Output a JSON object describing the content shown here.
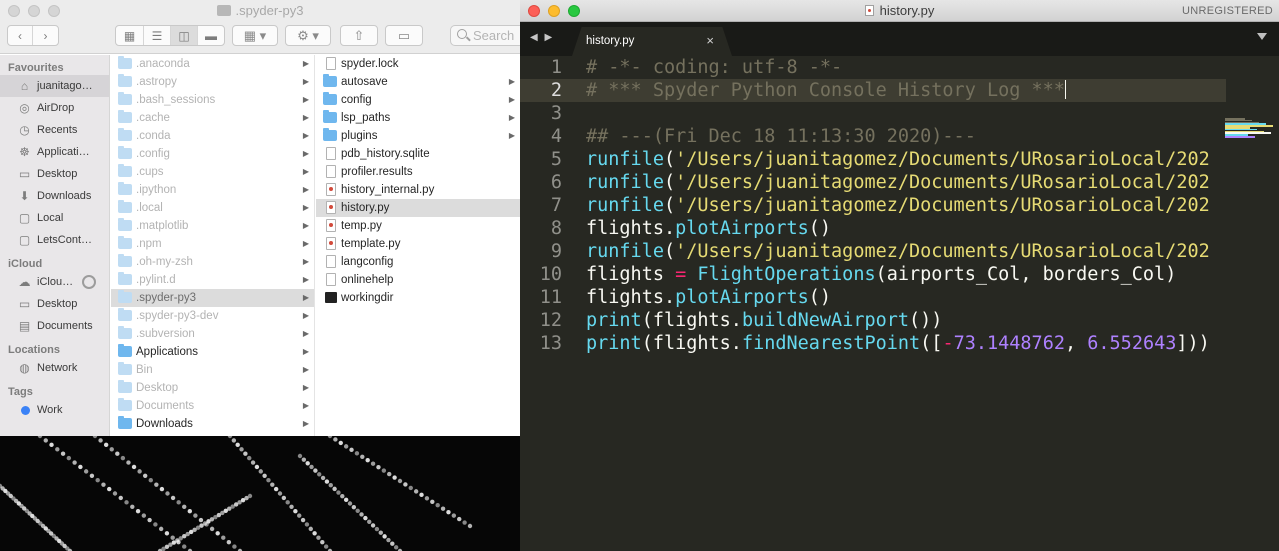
{
  "finder": {
    "window_title": ".spyder-py3",
    "search_placeholder": "Search",
    "sidebar": {
      "favourites_heading": "Favourites",
      "favourites": [
        {
          "label": "juanitago…",
          "icon": "home-icon",
          "selected": true
        },
        {
          "label": "AirDrop",
          "icon": "airdrop-icon"
        },
        {
          "label": "Recents",
          "icon": "clock-icon"
        },
        {
          "label": "Applicati…",
          "icon": "applications-icon"
        },
        {
          "label": "Desktop",
          "icon": "desktop-icon"
        },
        {
          "label": "Downloads",
          "icon": "downloads-icon"
        },
        {
          "label": "Local",
          "icon": "folder-icon"
        },
        {
          "label": "LetsCont…",
          "icon": "folder-icon"
        }
      ],
      "icloud_heading": "iCloud",
      "icloud": [
        {
          "label": "iClou…",
          "icon": "cloud-icon"
        },
        {
          "label": "Desktop",
          "icon": "desktop-icon"
        },
        {
          "label": "Documents",
          "icon": "document-icon"
        }
      ],
      "locations_heading": "Locations",
      "locations": [
        {
          "label": "Network",
          "icon": "globe-icon"
        }
      ],
      "tags_heading": "Tags",
      "tags": [
        {
          "label": "Work",
          "color": "#3b82f6"
        }
      ]
    },
    "column1": [
      {
        "name": ".anaconda",
        "dark": false
      },
      {
        "name": ".astropy",
        "dark": false
      },
      {
        "name": ".bash_sessions",
        "dark": false
      },
      {
        "name": ".cache",
        "dark": false
      },
      {
        "name": ".conda",
        "dark": false
      },
      {
        "name": ".config",
        "dark": false
      },
      {
        "name": ".cups",
        "dark": false
      },
      {
        "name": ".ipython",
        "dark": false
      },
      {
        "name": ".local",
        "dark": false
      },
      {
        "name": ".matplotlib",
        "dark": false
      },
      {
        "name": ".npm",
        "dark": false
      },
      {
        "name": ".oh-my-zsh",
        "dark": false
      },
      {
        "name": ".pylint.d",
        "dark": false
      },
      {
        "name": ".spyder-py3",
        "dark": false,
        "selected": true
      },
      {
        "name": ".spyder-py3-dev",
        "dark": false
      },
      {
        "name": ".subversion",
        "dark": false
      },
      {
        "name": "Applications",
        "dark": true
      },
      {
        "name": "Bin",
        "dark": false
      },
      {
        "name": "Desktop",
        "dark": false
      },
      {
        "name": "Documents",
        "dark": false
      },
      {
        "name": "Downloads",
        "dark": true
      }
    ],
    "column2": [
      {
        "name": "spyder.lock",
        "kind": "doc"
      },
      {
        "name": "autosave",
        "kind": "folder"
      },
      {
        "name": "config",
        "kind": "folder"
      },
      {
        "name": "lsp_paths",
        "kind": "folder"
      },
      {
        "name": "plugins",
        "kind": "folder"
      },
      {
        "name": "pdb_history.sqlite",
        "kind": "doc"
      },
      {
        "name": "profiler.results",
        "kind": "doc"
      },
      {
        "name": "history_internal.py",
        "kind": "py"
      },
      {
        "name": "history.py",
        "kind": "py",
        "selected": true
      },
      {
        "name": "temp.py",
        "kind": "py"
      },
      {
        "name": "template.py",
        "kind": "py"
      },
      {
        "name": "langconfig",
        "kind": "doc"
      },
      {
        "name": "onlinehelp",
        "kind": "doc"
      },
      {
        "name": "workingdir",
        "kind": "term"
      }
    ]
  },
  "editor": {
    "window_title": "history.py",
    "unregistered_label": "UNREGISTERED",
    "tab_label": "history.py",
    "tab_close": "×",
    "current_line": 2,
    "lines": [
      [
        {
          "t": "# -*- coding: utf-8 -*-",
          "c": "cmt"
        }
      ],
      [
        {
          "t": "# *** Spyder Python Console History Log ***",
          "c": "cmt"
        }
      ],
      [],
      [
        {
          "t": "## ---(Fri Dec 18 11:13:30 2020)---",
          "c": "cmt"
        }
      ],
      [
        {
          "t": "runfile",
          "c": "fn"
        },
        {
          "t": "(",
          "c": ""
        },
        {
          "t": "'/Users/juanitagomez/Documents/URosarioLocal/202",
          "c": "str"
        }
      ],
      [
        {
          "t": "runfile",
          "c": "fn"
        },
        {
          "t": "(",
          "c": ""
        },
        {
          "t": "'/Users/juanitagomez/Documents/URosarioLocal/202",
          "c": "str"
        }
      ],
      [
        {
          "t": "runfile",
          "c": "fn"
        },
        {
          "t": "(",
          "c": ""
        },
        {
          "t": "'/Users/juanitagomez/Documents/URosarioLocal/202",
          "c": "str"
        }
      ],
      [
        {
          "t": "flights.",
          "c": ""
        },
        {
          "t": "plotAirports",
          "c": "fn"
        },
        {
          "t": "()",
          "c": ""
        }
      ],
      [
        {
          "t": "runfile",
          "c": "fn"
        },
        {
          "t": "(",
          "c": ""
        },
        {
          "t": "'/Users/juanitagomez/Documents/URosarioLocal/202",
          "c": "str"
        }
      ],
      [
        {
          "t": "flights ",
          "c": ""
        },
        {
          "t": "=",
          "c": "op"
        },
        {
          "t": " ",
          "c": ""
        },
        {
          "t": "FlightOperations",
          "c": "fn"
        },
        {
          "t": "(airports_Col, borders_Col)",
          "c": ""
        }
      ],
      [
        {
          "t": "flights.",
          "c": ""
        },
        {
          "t": "plotAirports",
          "c": "fn"
        },
        {
          "t": "()",
          "c": ""
        }
      ],
      [
        {
          "t": "print",
          "c": "fn"
        },
        {
          "t": "(flights.",
          "c": ""
        },
        {
          "t": "buildNewAirport",
          "c": "fn"
        },
        {
          "t": "())",
          "c": ""
        }
      ],
      [
        {
          "t": "print",
          "c": "fn"
        },
        {
          "t": "(flights.",
          "c": ""
        },
        {
          "t": "findNearestPoint",
          "c": "fn"
        },
        {
          "t": "([",
          "c": ""
        },
        {
          "t": "-",
          "c": "op"
        },
        {
          "t": "73.1448762",
          "c": "num"
        },
        {
          "t": ", ",
          "c": ""
        },
        {
          "t": "6.552643",
          "c": "num"
        },
        {
          "t": "]))",
          "c": ""
        }
      ]
    ]
  }
}
